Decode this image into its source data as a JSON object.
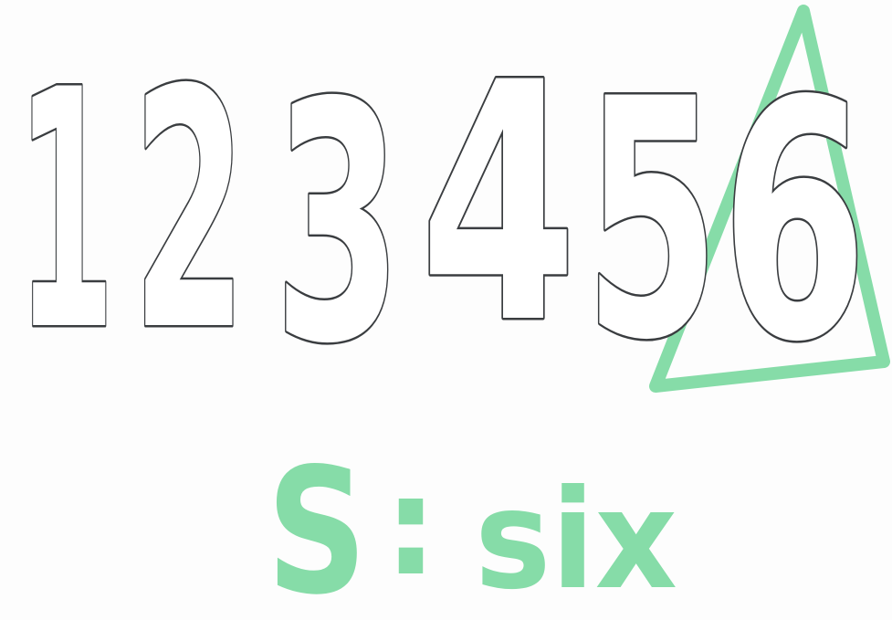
{
  "numbers": {
    "digits": [
      "1",
      "2",
      "3",
      "4",
      "5",
      "6"
    ]
  },
  "caption": {
    "letter": "S",
    "separator": ":",
    "word": "six"
  },
  "colors": {
    "outline": "#3a3d40",
    "marker_green": "#86dca8",
    "paper": "#fdfdfd"
  },
  "shapes": {
    "triangle": "green-triangle-outline"
  }
}
